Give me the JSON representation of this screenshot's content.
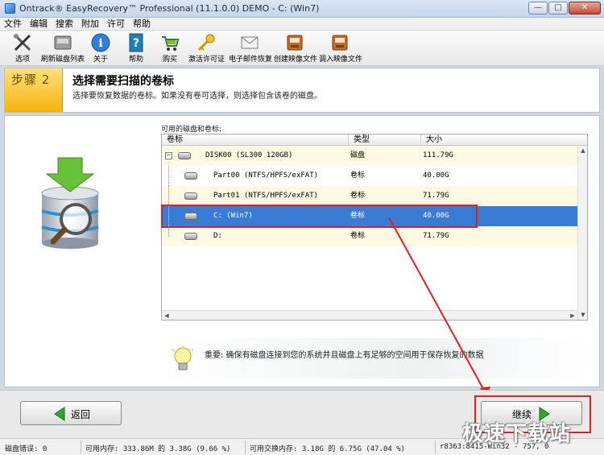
{
  "window": {
    "title": "Ontrack® EasyRecovery™ Professional (11.1.0.0) DEMO - C: (Win7)",
    "controls": {
      "minimize": "—",
      "maximize": "□",
      "close": "✕"
    }
  },
  "menu": [
    "文件",
    "编辑",
    "搜索",
    "附加",
    "许可",
    "帮助"
  ],
  "toolbar": [
    {
      "label": "选项",
      "icon": "tools-icon"
    },
    {
      "label": "刷新磁盘列表",
      "icon": "refresh-disk-icon"
    },
    {
      "label": "关于",
      "icon": "info-icon"
    },
    {
      "label": "帮助",
      "icon": "help-icon"
    },
    {
      "label": "购买",
      "icon": "cart-icon"
    },
    {
      "label": "激活许可证",
      "icon": "key-icon"
    },
    {
      "label": "电子邮件恢复",
      "icon": "mail-icon"
    },
    {
      "label": "创建映像文件",
      "icon": "create-image-icon"
    },
    {
      "label": "调入映像文件",
      "icon": "load-image-icon"
    }
  ],
  "step": {
    "badge": "步骤 2",
    "title": "选择需要扫描的卷标",
    "description": "选择要恢复数据的卷标。如果没有卷可选择，则选择包含该卷的磁盘。"
  },
  "volumes": {
    "caption": "可用的磁盘和卷标:",
    "columns": [
      "卷标",
      "类型",
      "大小"
    ],
    "rows": [
      {
        "name": "DISK00 (SL300 120GB)",
        "type": "磁盘",
        "size": "111.79G",
        "level": 0,
        "selected": false
      },
      {
        "name": "Part00 (NTFS/HPFS/exFAT)",
        "type": "卷标",
        "size": "40.00G",
        "level": 1,
        "selected": false
      },
      {
        "name": "Part01 (NTFS/HPFS/exFAT)",
        "type": "卷标",
        "size": "71.79G",
        "level": 1,
        "selected": false
      },
      {
        "name": "C: (Win7)",
        "type": "卷标",
        "size": "40.00G",
        "level": 1,
        "selected": true
      },
      {
        "name": "D:",
        "type": "卷标",
        "size": "71.79G",
        "level": 1,
        "selected": false
      }
    ]
  },
  "note": "重要: 确保有磁盘连接到您的系统并且磁盘上有足够的空间用于保存恢复的数据",
  "buttons": {
    "back": "返回",
    "next": "继续"
  },
  "status": {
    "disk_errors": "磁盘错误: 0",
    "memory": "可用内存: 333.86M 的 3.38G (9.66 %)",
    "swap": "可用交换内存: 3.18G 的 6.75G (47.04 %)",
    "build": "r8363:8415-Win32 - 757, 0"
  },
  "watermark": "极速下载站",
  "colors": {
    "selection": "#3a7bd5",
    "step_badge": "#f6b30e",
    "highlight": "#e02020",
    "next_arrow": "#2fa82f"
  }
}
